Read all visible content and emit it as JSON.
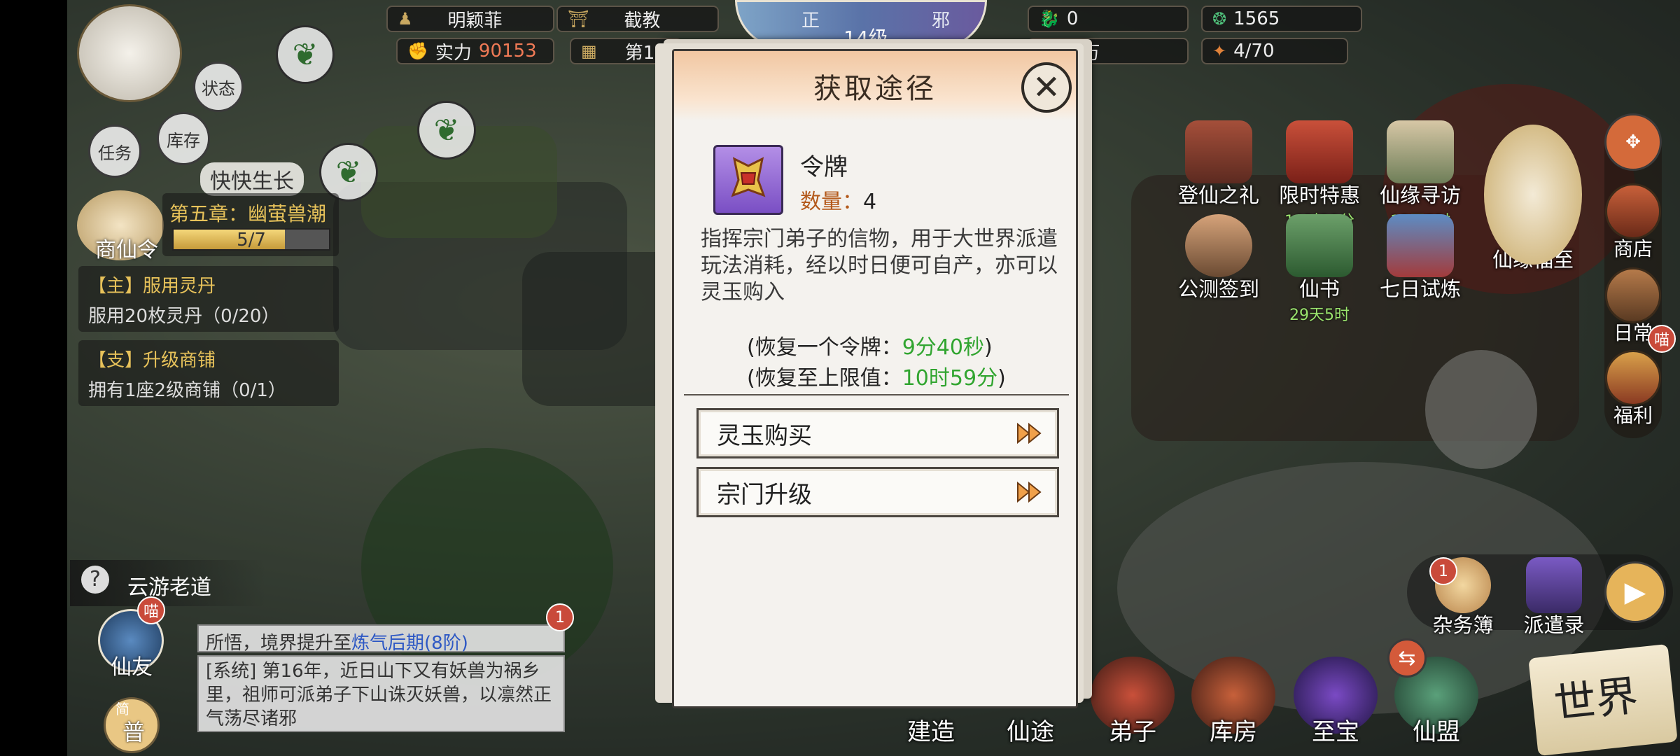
{
  "top_bar": {
    "player_name": "明颖菲",
    "sect_name": "截教",
    "power_label": "实力",
    "power_value": "90153",
    "year_label": "第16",
    "alignment_left": "正",
    "alignment_right": "邪",
    "level": "14级",
    "resource1": "0",
    "resource2": "1565",
    "resource3": "54万",
    "resource4": "4/70"
  },
  "avatar_buttons": {
    "status": "状态",
    "task": "任务",
    "storage": "库存",
    "grow_banner": "快快生长"
  },
  "chapter": {
    "title": "第五章：幽萤兽潮",
    "progress": "5/7",
    "progress_fraction": 0.714,
    "token_label": "商仙令"
  },
  "quests": [
    {
      "title": "【主】服用灵丹",
      "desc": "服用20枚灵丹（0/20）"
    },
    {
      "title": "【支】升级商铺",
      "desc": "拥有1座2级商铺（0/1）"
    }
  ],
  "npc": {
    "name": "云游老道"
  },
  "left_bottom": {
    "friend": "仙友",
    "friend_badge": "喵",
    "general": "普",
    "general_badge": "简"
  },
  "chat": {
    "badge": "1",
    "line1_prefix": "所悟，境界提升至",
    "line1_highlight": "炼气后期(8阶)",
    "line2": "[系统] 第16年，近日山下又有妖兽为祸乡里，祖师可派弟子下山诛灭妖兽，以凛然正气荡尽诸邪"
  },
  "activities": [
    {
      "label": "登仙之礼",
      "timer": ""
    },
    {
      "label": "限时特惠",
      "timer": "19时30分"
    },
    {
      "label": "仙缘寻访",
      "timer": "13天5时"
    },
    {
      "label": "公测签到",
      "timer": ""
    },
    {
      "label": "仙书",
      "timer": "29天5时"
    },
    {
      "label": "七日试炼",
      "timer": ""
    },
    {
      "label": "仙缘福至",
      "timer": ""
    }
  ],
  "side_buttons": [
    {
      "label": "商店"
    },
    {
      "label": "日常",
      "badge": "喵"
    },
    {
      "label": "福利"
    }
  ],
  "right_panel": {
    "chores": "杂务簿",
    "chores_badge": "1",
    "dispatch": "派遣录"
  },
  "bottom_nav": [
    {
      "label": "建造"
    },
    {
      "label": "仙途"
    },
    {
      "label": "弟子"
    },
    {
      "label": "库房"
    },
    {
      "label": "至宝"
    },
    {
      "label": "仙盟"
    }
  ],
  "world_button": "世界",
  "modal": {
    "title": "获取途径",
    "item_name": "令牌",
    "qty_label": "数量：",
    "qty_value": "4",
    "description": "指挥宗门弟子的信物，用于大世界派遣玩法消耗，经以时日便可自产，亦可以灵玉购入",
    "recover_one_label": "(恢复一个令牌：",
    "recover_one_value": "9分40秒",
    "recover_full_label": "(恢复至上限值：",
    "recover_full_value": "10时59分",
    "close_paren": ")",
    "sources": [
      {
        "label": "灵玉购买"
      },
      {
        "label": "宗门升级"
      }
    ]
  },
  "colors": {
    "accent_gold": "#e7c25a",
    "green_value": "#31a530",
    "red_power": "#f07a56",
    "item_purple": "#7a4fc4"
  }
}
